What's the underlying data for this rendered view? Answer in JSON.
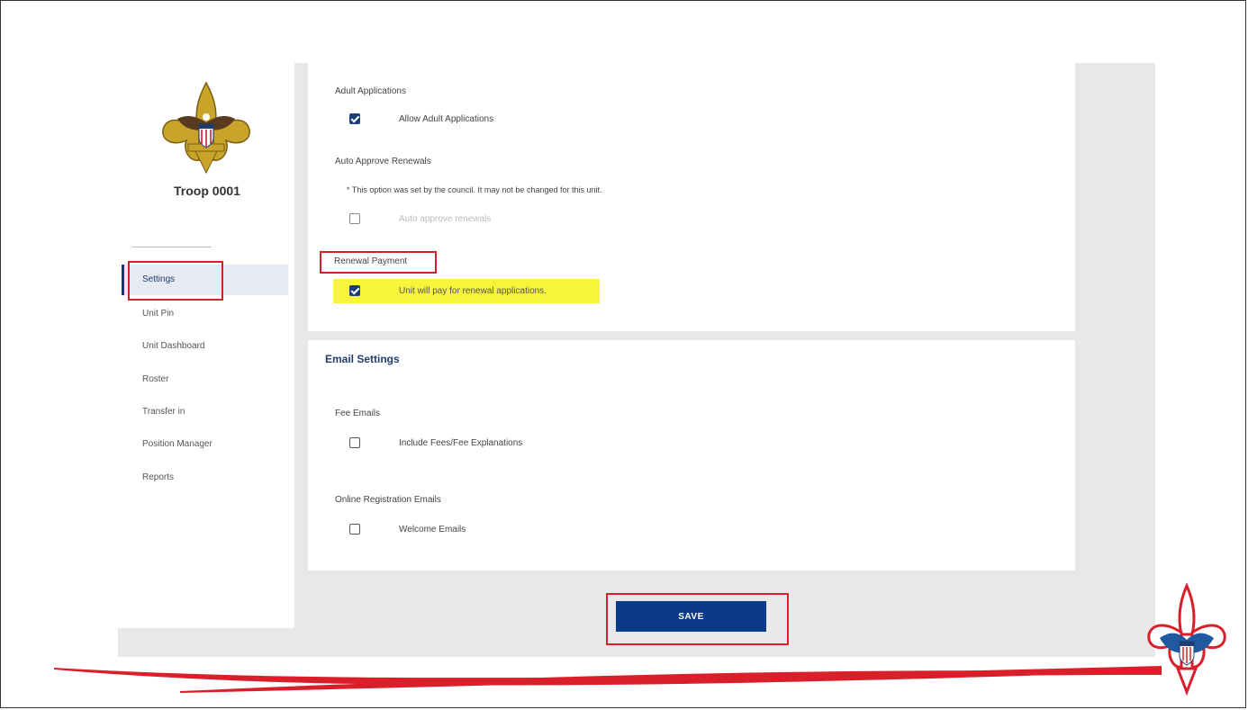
{
  "sidebar": {
    "unit_name": "Troop 0001",
    "items": [
      {
        "label": "Settings",
        "active": true
      },
      {
        "label": "Unit Pin"
      },
      {
        "label": "Unit Dashboard"
      },
      {
        "label": "Roster"
      },
      {
        "label": "Transfer in"
      },
      {
        "label": "Position Manager"
      },
      {
        "label": "Reports"
      }
    ]
  },
  "settings": {
    "adult_applications": {
      "heading": "Adult Applications",
      "option_label": "Allow Adult Applications",
      "checked": true
    },
    "auto_approve": {
      "heading": "Auto Approve Renewals",
      "note": "* This option was set by the council. It may not be changed for this unit.",
      "option_label": "Auto approve renewals",
      "checked": false
    },
    "renewal_payment": {
      "heading": "Renewal Payment",
      "option_label": "Unit will pay for renewal applications.",
      "checked": true
    }
  },
  "email_settings": {
    "title": "Email Settings",
    "fee_emails": {
      "heading": "Fee Emails",
      "option_label": "Include Fees/Fee Explanations",
      "checked": false
    },
    "online_registration": {
      "heading": "Online Registration Emails",
      "option_label": "Welcome Emails",
      "checked": false
    }
  },
  "actions": {
    "save_label": "SAVE"
  },
  "colors": {
    "brand_blue": "#0b3a86",
    "annotation_red": "#d9202a",
    "highlight_yellow": "#f7f43a"
  }
}
